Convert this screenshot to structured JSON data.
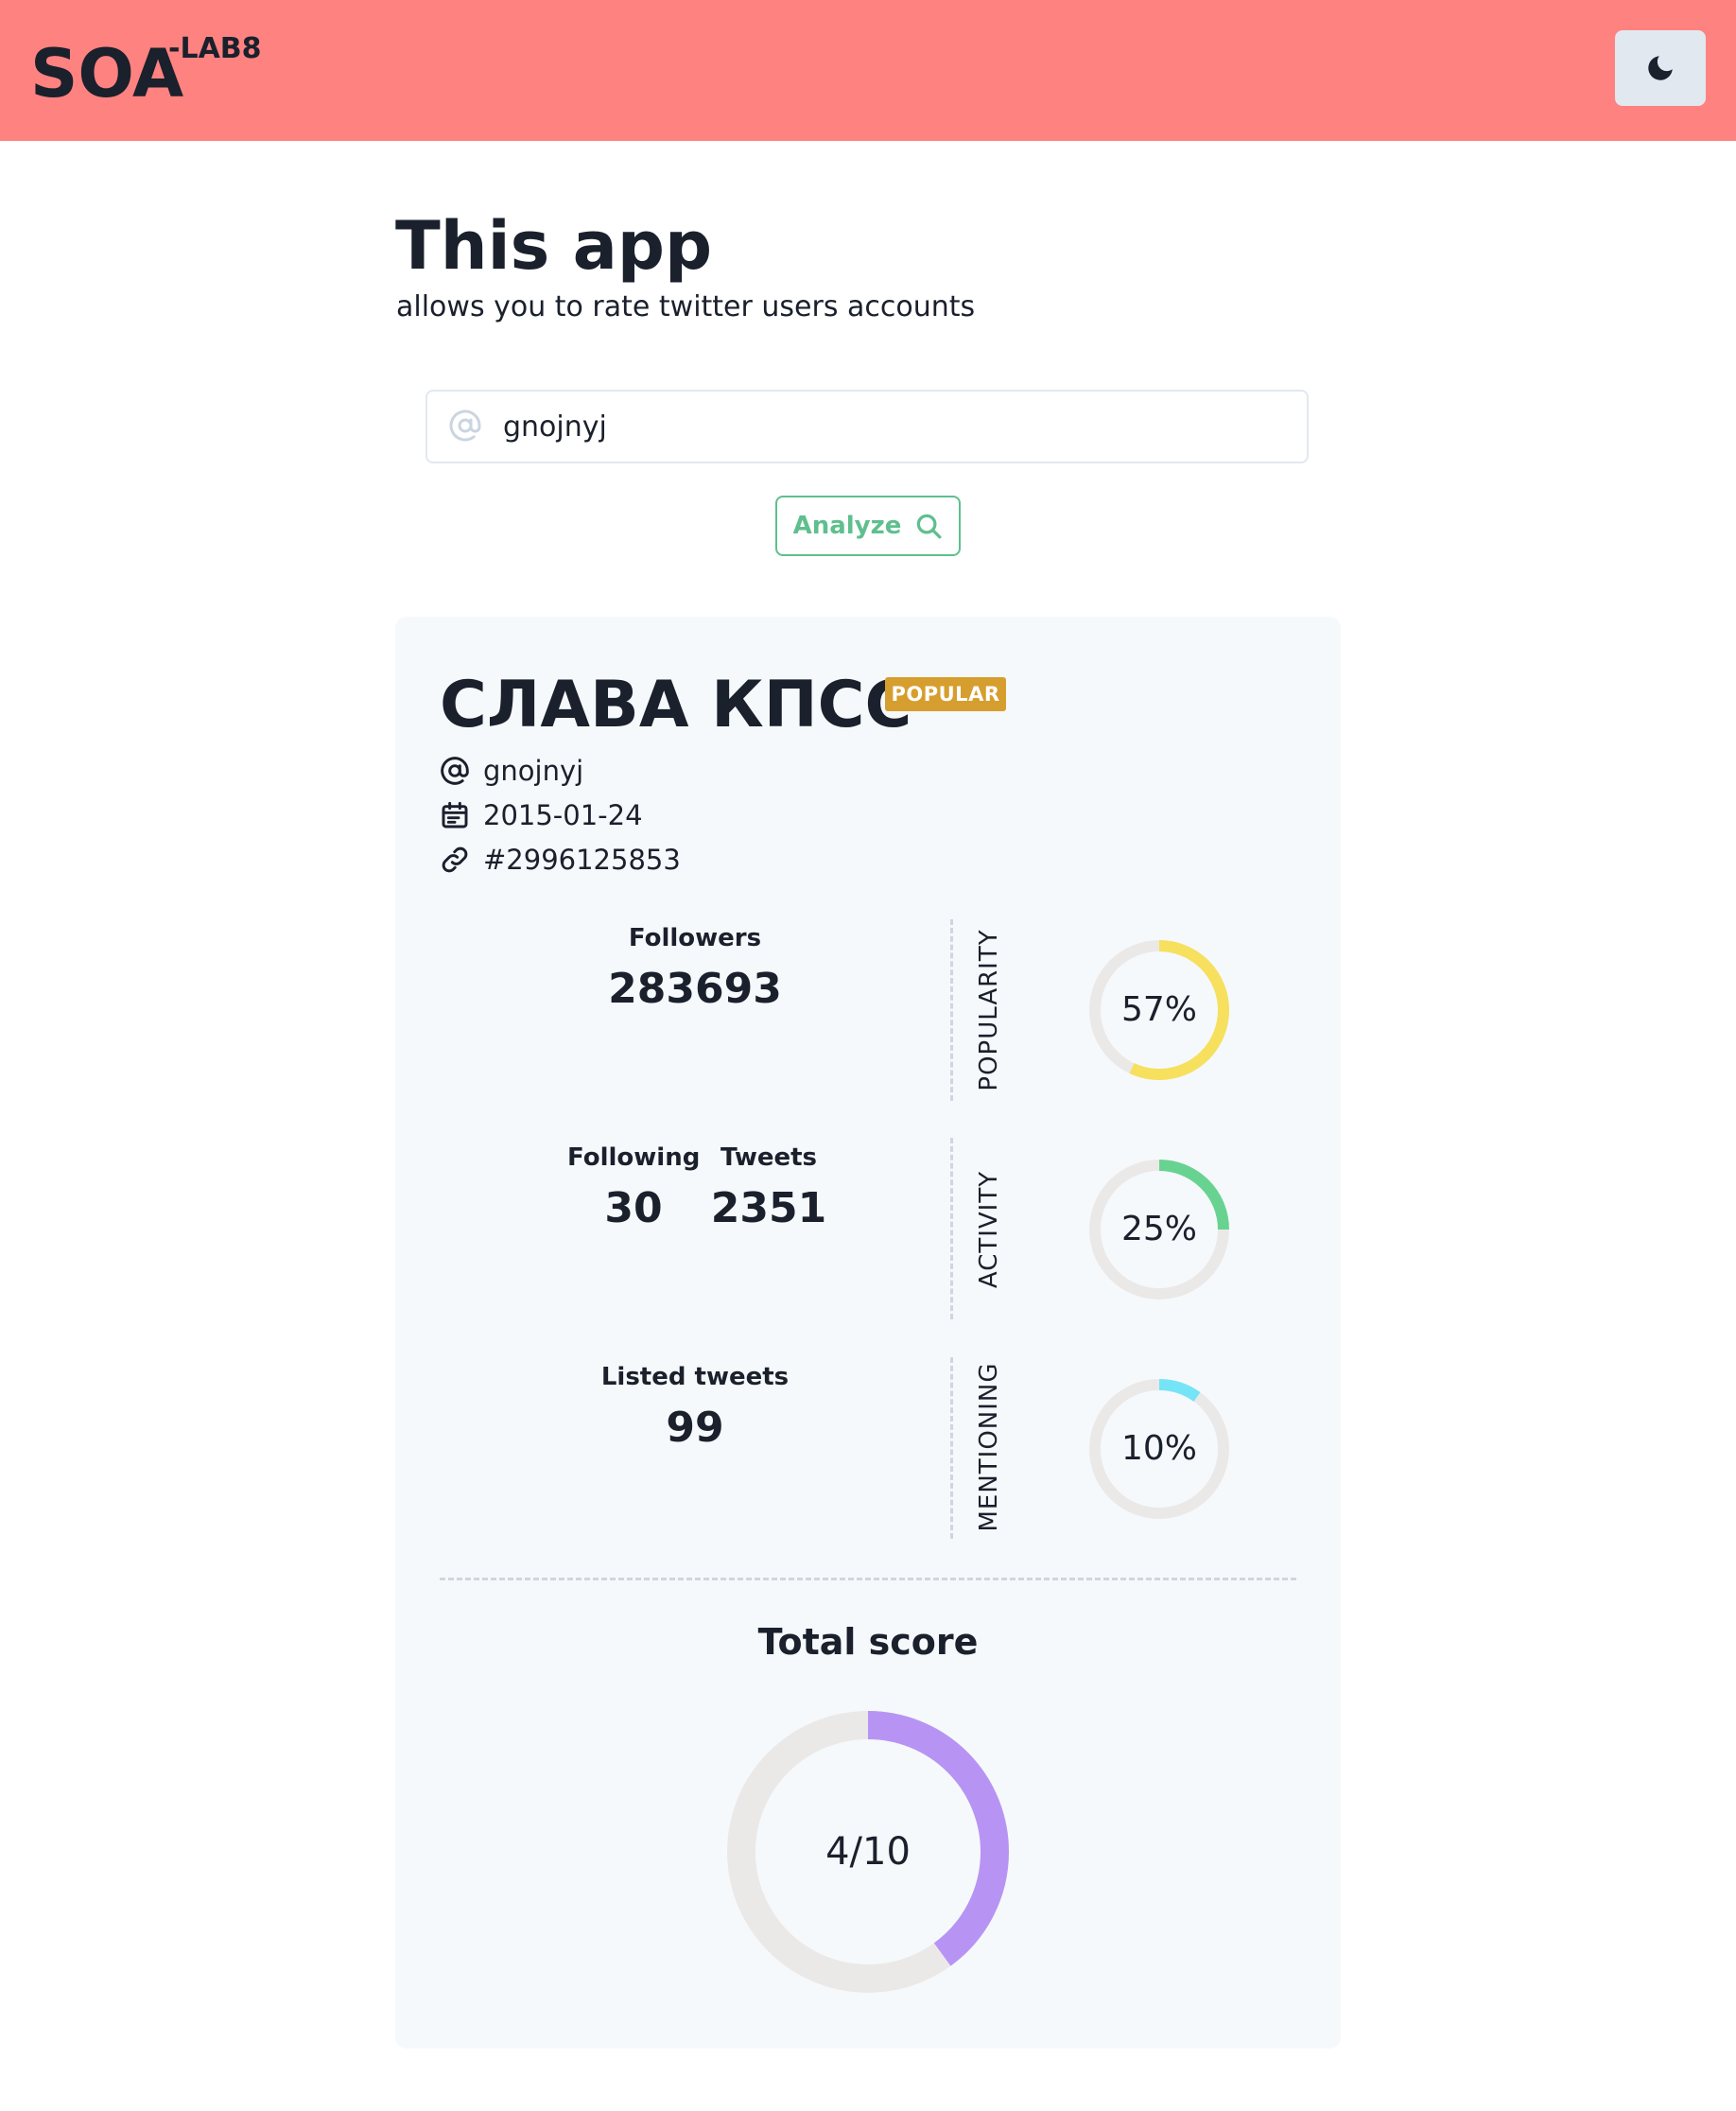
{
  "header": {
    "brand": "SOA",
    "brand_suffix": "-LAB8",
    "theme_toggle_icon": "moon-icon"
  },
  "intro": {
    "title": "This app",
    "subtitle": "allows you to rate twitter users accounts"
  },
  "search": {
    "value": "gnojnyj",
    "icon": "at-icon",
    "button_label": "Analyze",
    "button_icon": "search-icon"
  },
  "profile": {
    "name": "СЛАВА КПСС",
    "badge": "POPULAR",
    "username": "gnojnyj",
    "created": "2015-01-24",
    "id": "#2996125853"
  },
  "stats": {
    "followers_label": "Followers",
    "followers": "283693",
    "following_label": "Following",
    "following": "30",
    "tweets_label": "Tweets",
    "tweets": "2351",
    "listed_label": "Listed tweets",
    "listed": "99"
  },
  "scores": {
    "popularity": {
      "label": "POPULARITY",
      "value": 57,
      "text": "57%",
      "color": "#f6e05e"
    },
    "activity": {
      "label": "ACTIVITY",
      "value": 25,
      "text": "25%",
      "color": "#68d391"
    },
    "mentioning": {
      "label": "MENTIONING",
      "value": 10,
      "text": "10%",
      "color": "#76e4f7"
    }
  },
  "total": {
    "title": "Total score",
    "value": 4,
    "max": 10,
    "text": "4/10",
    "color": "#b794f4"
  },
  "colors": {
    "header_bg": "#fe8280",
    "analyze_accent": "#5fbf8e",
    "badge_bg": "#d69e2e",
    "track": "#ebe9e8"
  }
}
